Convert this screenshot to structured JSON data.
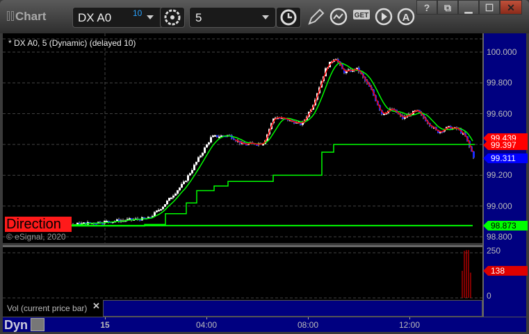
{
  "window": {
    "title": "Chart",
    "symbol": "DX A0",
    "symbol_badge": "10",
    "interval": "5",
    "buttons": [
      "?",
      "restore",
      "minimize",
      "maximize",
      "close"
    ]
  },
  "toolbar": {
    "icons": [
      "settings-icon",
      "clock-icon",
      "pencil-icon",
      "study-icon",
      "get-icon",
      "play-icon",
      "alert-icon"
    ]
  },
  "chart": {
    "legend": "* DX A0, 5 (Dynamic) (delayed 10)",
    "direction_label": "Direction",
    "copyright": "© eSignal, 2020",
    "price_ticks": [
      "100.000",
      "99.800",
      "99.600",
      "99.400",
      "99.200",
      "99.000",
      "98.800"
    ],
    "price_tick_values": [
      100.0,
      99.8,
      99.6,
      99.4,
      99.2,
      99.0,
      98.8
    ],
    "tags": [
      {
        "label": "99.439",
        "value": 99.439,
        "color": "#ff0000"
      },
      {
        "label": "99.397",
        "value": 99.397,
        "color": "#ff0000"
      },
      {
        "label": "99.311",
        "value": 99.311,
        "color": "#0000ff"
      },
      {
        "label": "98.873",
        "value": 98.873,
        "color": "#00ff00"
      }
    ],
    "price_path": [
      [
        0,
        98.88
      ],
      [
        30,
        98.87
      ],
      [
        95,
        98.88
      ],
      [
        145,
        98.9
      ],
      [
        205,
        98.92
      ],
      [
        225,
        99.0
      ],
      [
        255,
        99.15
      ],
      [
        275,
        99.3
      ],
      [
        295,
        99.45
      ],
      [
        320,
        99.46
      ],
      [
        340,
        99.4
      ],
      [
        370,
        99.41
      ],
      [
        385,
        99.58
      ],
      [
        405,
        99.56
      ],
      [
        425,
        99.53
      ],
      [
        440,
        99.65
      ],
      [
        460,
        99.9
      ],
      [
        473,
        99.97
      ],
      [
        485,
        99.87
      ],
      [
        505,
        99.89
      ],
      [
        525,
        99.75
      ],
      [
        540,
        99.6
      ],
      [
        555,
        99.63
      ],
      [
        570,
        99.57
      ],
      [
        590,
        99.62
      ],
      [
        605,
        99.55
      ],
      [
        620,
        99.48
      ],
      [
        635,
        99.51
      ],
      [
        650,
        99.5
      ],
      [
        660,
        99.45
      ],
      [
        673,
        99.31
      ]
    ],
    "slow_step": [
      [
        0,
        98.87
      ],
      [
        200,
        98.88
      ],
      [
        230,
        98.95
      ],
      [
        260,
        99.02
      ],
      [
        275,
        99.1
      ],
      [
        300,
        99.13
      ],
      [
        320,
        99.16
      ],
      [
        380,
        99.16
      ],
      [
        385,
        99.2
      ],
      [
        440,
        99.2
      ],
      [
        455,
        99.35
      ],
      [
        472,
        99.4
      ],
      [
        675,
        99.4
      ]
    ],
    "base_line": 98.873
  },
  "volume": {
    "label": "Vol (current price bar)",
    "ticks": [
      "250",
      "0"
    ],
    "tick_values": [
      250,
      0
    ],
    "tag": "138",
    "tag_value": 138,
    "bars": [
      150,
      260,
      265,
      265,
      140
    ]
  },
  "time_axis": {
    "mode": "Dyn",
    "labels": [
      "15",
      "04:00",
      "08:00",
      "12:00"
    ]
  }
}
